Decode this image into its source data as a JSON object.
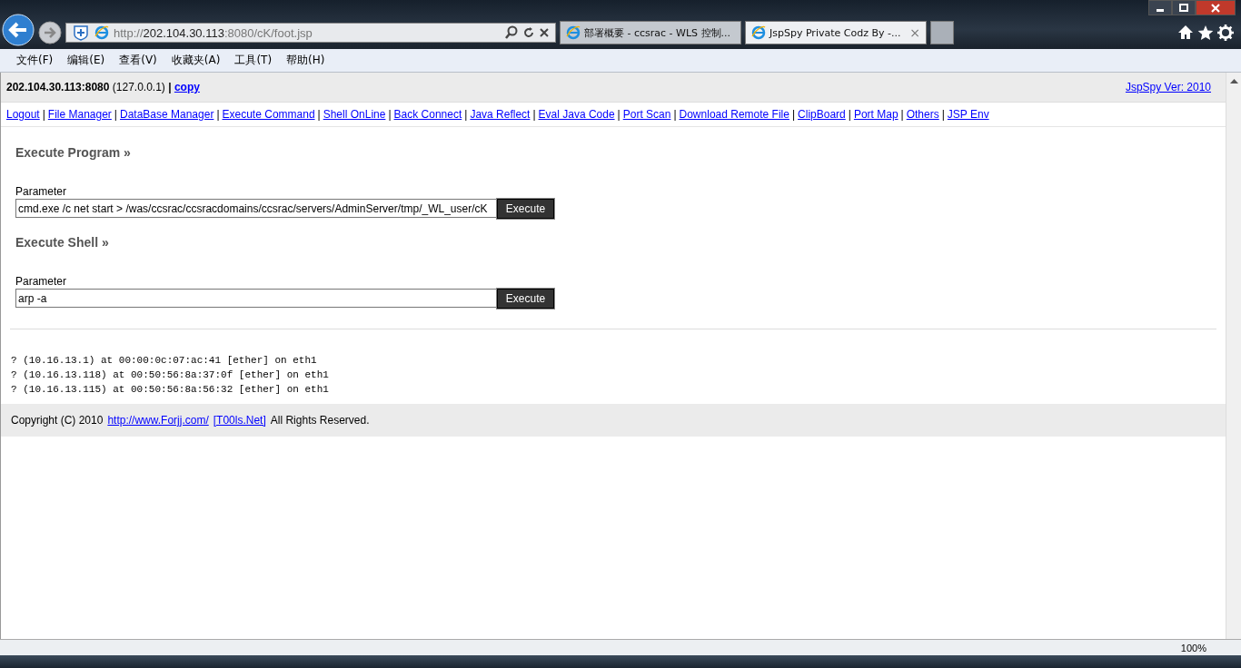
{
  "browser": {
    "address": {
      "scheme": "http://",
      "host": "202.104.30.113",
      "path": ":8080/cK/foot.jsp"
    },
    "tabs": [
      {
        "title": "部署概要 - ccsrac - WLS 控制...",
        "selected": false
      },
      {
        "title": "JspSpy Private Codz By -...",
        "selected": true
      }
    ],
    "tab_close": "×",
    "menu": [
      "文件(F)",
      "编辑(E)",
      "查看(V)",
      "收藏夹(A)",
      "工具(T)",
      "帮助(H)"
    ]
  },
  "page": {
    "host": "202.104.30.113:8080",
    "local": "(127.0.0.1)",
    "separator": "|",
    "copy_link": "copy",
    "version_link": "JspSpy Ver: 2010",
    "nav": [
      "Logout",
      "File Manager",
      "DataBase Manager",
      "Execute Command",
      "Shell OnLine",
      "Back Connect",
      "Java Reflect",
      "Eval Java Code",
      "Port Scan",
      "Download Remote File",
      "ClipBoard",
      "Port Map",
      "Others",
      "JSP Env"
    ],
    "sections": [
      {
        "heading": "Execute Program »",
        "label": "Parameter",
        "value": "cmd.exe /c net start > /was/ccsrac/ccsracdomains/ccsrac/servers/AdminServer/tmp/_WL_user/cK",
        "button": "Execute"
      },
      {
        "heading": "Execute Shell »",
        "label": "Parameter",
        "value": "arp -a",
        "button": "Execute"
      }
    ],
    "output": [
      "? (10.16.13.1) at 00:00:0c:07:ac:41 [ether] on eth1",
      "? (10.16.13.118) at 00:50:56:8a:37:0f [ether] on eth1",
      "? (10.16.13.115) at 00:50:56:8a:56:32 [ether] on eth1"
    ],
    "footer": {
      "prefix": "Copyright (C) 2010",
      "site_link": "http://www.Forjj.com/",
      "tools_link": "[T00ls.Net]",
      "suffix": "All Rights Reserved."
    }
  },
  "status_bar": {
    "zoom": "100%"
  }
}
